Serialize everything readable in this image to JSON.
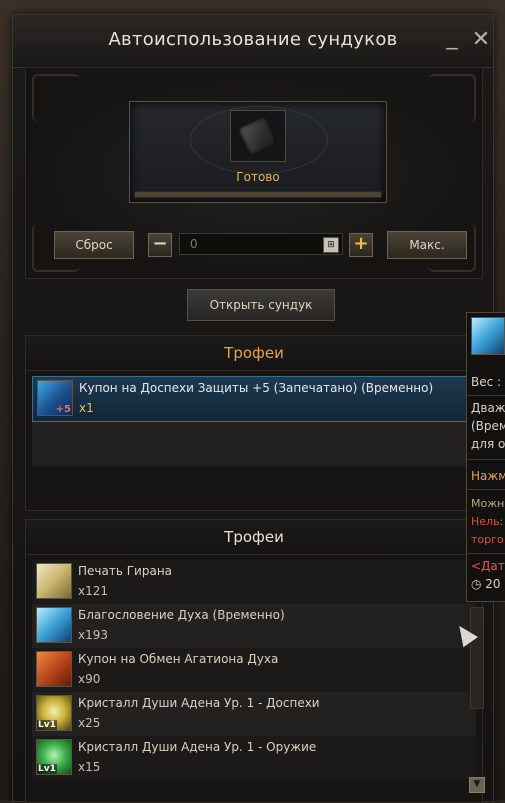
{
  "window": {
    "title": "Автоиспользование сундуков",
    "minimize_glyph": "_",
    "close_glyph": "✕"
  },
  "chest": {
    "status": "Готово"
  },
  "controls": {
    "reset_label": "Сброс",
    "minus_glyph": "−",
    "quantity_value": "0",
    "calc_glyph": "⊞",
    "plus_glyph": "+",
    "max_label": "Макс.",
    "open_label": "Открыть сундук"
  },
  "trophies_result": {
    "heading": "Трофеи",
    "items": [
      {
        "name": "Купон на Доспехи Защиты +5 (Запечатано) (Временно)",
        "count": "x1",
        "enchant": "+5",
        "icon": "armor-coupon-icon"
      }
    ]
  },
  "trophies_list": {
    "heading": "Трофеи",
    "items": [
      {
        "name": "Печать Гирана",
        "count": "x121",
        "icon": "giran-seal-icon"
      },
      {
        "name": "Благословение Духа (Временно)",
        "count": "x193",
        "icon": "spirit-blessing-icon"
      },
      {
        "name": "Купон на Обмен Агатиона Духа",
        "count": "x90",
        "icon": "agathion-coupon-icon"
      },
      {
        "name": "Кристалл Души Адена Ур. 1 - Доспехи",
        "count": "x25",
        "level": "Lv1",
        "icon": "soul-crystal-armor-icon"
      },
      {
        "name": "Кристалл Души Адена Ур. 1 - Оружие",
        "count": "x15",
        "level": "Lv1",
        "icon": "soul-crystal-weapon-icon"
      }
    ]
  },
  "scroll": {
    "down_glyph": "▼"
  },
  "tooltip": {
    "weight_label": "Вес :",
    "desc_1": "Дваж",
    "desc_2": "(Врем",
    "desc_3": "для о",
    "action": "Нажм",
    "note_1": "Можн",
    "note_2": "Нель:",
    "note_3": "торго",
    "date_label": "<Дат",
    "timer_value": "20"
  },
  "colors": {
    "accent_gold": "#e6a14a",
    "selected_row": "#1e3a50",
    "warning_red": "#e0503a"
  }
}
